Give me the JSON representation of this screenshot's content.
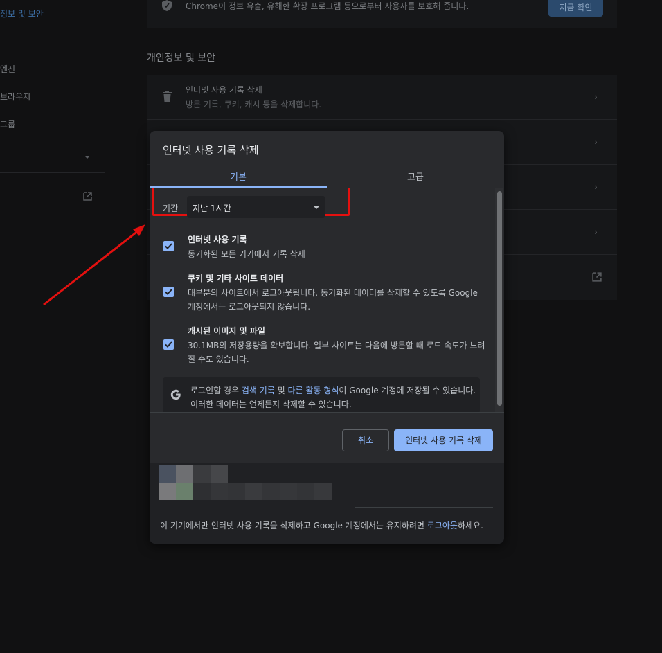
{
  "sidebar": {
    "items": [
      {
        "label": "정보 및 보안",
        "active": true
      },
      {
        "label": "엔진"
      },
      {
        "label": "브라우저"
      },
      {
        "label": "그룹"
      }
    ]
  },
  "background": {
    "safety_text": "Chrome이 정보 유출, 유해한 확장 프로그램 등으로부터 사용자를 보호해 줍니다.",
    "safety_button": "지금 확인",
    "section_title": "개인정보 및 보안",
    "rows": [
      {
        "title": "인터넷 사용 기록 삭제",
        "sub": "방문 기록, 쿠키, 캐시 등을 삭제합니다."
      }
    ]
  },
  "dialog": {
    "title": "인터넷 사용 기록 삭제",
    "tabs": [
      {
        "label": "기본",
        "active": true
      },
      {
        "label": "고급",
        "active": false
      }
    ],
    "period": {
      "label": "기간",
      "value": "지난 1시간"
    },
    "items": [
      {
        "title": "인터넷 사용 기록",
        "desc": "동기화된 모든 기기에서 기록 삭제",
        "checked": true
      },
      {
        "title": "쿠키 및 기타 사이트 데이터",
        "desc": "대부분의 사이트에서 로그아웃됩니다. 동기화된 데이터를 삭제할 수 있도록 Google 계정에서는 로그아웃되지 않습니다.",
        "checked": true
      },
      {
        "title": "캐시된 이미지 및 파일",
        "desc": "30.1MB의 저장용량을 확보합니다. 일부 사이트는 다음에 방문할 때 로드 속도가 느려질 수도 있습니다.",
        "checked": true
      }
    ],
    "google_note": {
      "prefix": "로그인할 경우 ",
      "link1": "검색 기록",
      "mid": " 및 ",
      "link2": "다른 활동 형식",
      "suffix": "이 Google 계정에 저장될 수 있습니다. 이러한 데이터는 언제든지 삭제할 수 있습니다."
    },
    "buttons": {
      "cancel": "취소",
      "delete": "인터넷 사용 기록 삭제"
    },
    "account_note": {
      "prefix": "이 기기에서만 인터넷 사용 기록을 삭제하고 Google 계정에서는 유지하려면 ",
      "link": "로그아웃",
      "suffix": "하세요."
    }
  },
  "colors": {
    "accent": "#8ab4f8",
    "highlight": "#e4100f"
  }
}
